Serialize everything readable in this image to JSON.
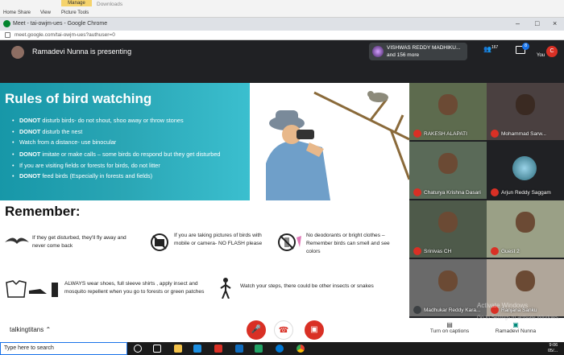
{
  "ribbon": {
    "file": "Home",
    "share": "Share",
    "view": "View",
    "picture_tools": "Picture Tools",
    "manage": "Manage",
    "downloads": "Downloads"
  },
  "chrome": {
    "title": "Meet - tai-owjm-ues - Google Chrome",
    "url": "meet.google.com/tai-owjm-ues?authuser=0"
  },
  "meet": {
    "presenting": "Ramadevi Nunna is presenting",
    "people_name": "VISHWAS REDDY MADHIKU...",
    "people_more": "and 156 more",
    "participant_count": "167",
    "chat_badge": "8",
    "you_label": "You",
    "you_initial": "C"
  },
  "slide": {
    "title": "Rules of bird watching",
    "rules": [
      {
        "bold": "DONOT",
        "text": " disturb birds- do not shout, shoo away or throw stones"
      },
      {
        "bold": "DONOT",
        "text": " disturb the nest"
      },
      {
        "bold": "",
        "text": "Watch from a distance- use binocular"
      },
      {
        "bold": "DONOT",
        "text": " imitate or make calls – some birds do respond but they get disturbed"
      },
      {
        "bold": "",
        "text": "If you are visiting fields or forests for birds, do not litter"
      },
      {
        "bold": "DONOT",
        "text": " feed birds (Especially in forests and fields)"
      }
    ],
    "remember": "Remember:",
    "tips": [
      "If they get disturbed, they'll fly away and never come back",
      "If you are taking pictures of birds with mobile or camera- NO FLASH please",
      "No deodorants or bright clothes – Remember birds can smell and see colors",
      "ALWAYS wear shoes, full sleeve shirts , apply insect and mosquito repellent when you go to forests or green patches",
      "Watch your steps, there could be other insects or snakes"
    ]
  },
  "tiles": [
    {
      "name": "RAKESH ALAPATI"
    },
    {
      "name": "Mohammad Sarw..."
    },
    {
      "name": "Chaturya Krishna Dasari"
    },
    {
      "name": "Arjun Reddy Saggam"
    },
    {
      "name": "Srinivas CH"
    },
    {
      "name": "Guest 2"
    },
    {
      "name": "Madhukar Reddy Kara..."
    },
    {
      "name": "Ranjana Sanku"
    }
  ],
  "controls": {
    "meeting_name": "talkingtitans",
    "captions": "Turn on captions",
    "presenter": "Ramadevi Nunna",
    "activate": "Activate Windows",
    "activate_sub": "Go to Settings to activate Windows."
  },
  "taskbar": {
    "search_placeholder": "Type here to search",
    "time": "9:06",
    "date": "05/..."
  },
  "colors": {
    "mic_off": "#d93025",
    "slide_header": "#1797a8",
    "meet_bg": "#202124"
  }
}
